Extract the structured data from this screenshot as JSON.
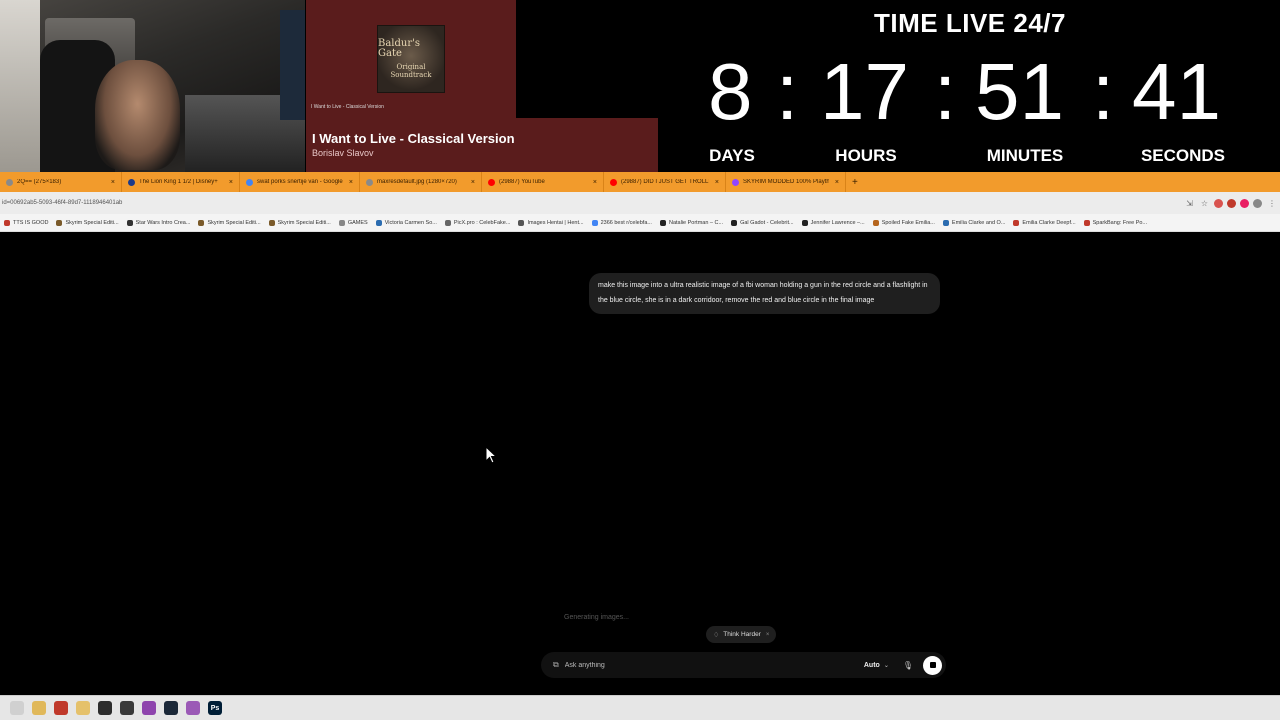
{
  "now_playing": {
    "album_title": "Baldur's Gate",
    "album_subtitle": "Original Soundtrack",
    "small_caption": "I Want to Live - Classical Version",
    "title": "I Want to Live - Classical Version",
    "artist": "Borislav Slavov",
    "color_bg": "#5a1c1c"
  },
  "countdown": {
    "title": "TIME LIVE 24/7",
    "days": "8",
    "hours": "17",
    "minutes": "51",
    "seconds": "41",
    "separator": ":",
    "days_label": "DAYS",
    "hours_label": "HOURS",
    "minutes_label": "MINUTES",
    "seconds_label": "SECONDS"
  },
  "browser": {
    "tab_color": "#f29b2c",
    "tabs": [
      {
        "label": "2Q== (275×183)",
        "icon": "image-icon",
        "color": "#8a8a8a"
      },
      {
        "label": "The Lion King 1 1/2 | Disney+",
        "icon": "disney-icon",
        "color": "#1b3a8a"
      },
      {
        "label": "swat porks snertije van - Google",
        "icon": "google-icon",
        "color": "#4285f4"
      },
      {
        "label": "maxresdefault.jpg (1280×720)",
        "icon": "image-icon",
        "color": "#8a8a8a"
      },
      {
        "label": "(29887) YouTube",
        "icon": "youtube-icon",
        "color": "#ff0000"
      },
      {
        "label": "(29887) DID I JUST GET TROLL!",
        "icon": "youtube-icon",
        "color": "#ff0000"
      },
      {
        "label": "SKYRIM MODDED 100% Playthr",
        "icon": "twitch-icon",
        "color": "#9146ff"
      }
    ],
    "new_tab": "+",
    "close_glyph": "×",
    "url": "id=00692ab5-5093-46f4-89d7-1118946401ab",
    "bookmarks": [
      "TTS IS GOOD",
      "Skyrim Special Editi...",
      "Star Wars Intro Crea...",
      "Skyrim Special Editi...",
      "Skyrim Special Editi...",
      "GAMES",
      "Victoria Carmen So...",
      "PicX.pro : CelebFake...",
      "Images Hentai | Hent...",
      "2366 best r/celebfa...",
      "Natalie Portman – C...",
      "Gal Gadot - Celebrit...",
      "Jennifer Lawrence –...",
      "Spoiled Fake Emilia...",
      "Emilia Clarke and O...",
      "Emilia Clarke Deepf...",
      "SparkBang: Free Po..."
    ]
  },
  "chat": {
    "user_message": "make this image into a ultra realistic image of a fbi woman holding a gun in the red circle and a flashlight in the blue circle, she is in a dark corridoor, remove the red and blue circle in the final image",
    "status": "Generating images...",
    "think_harder": "Think Harder",
    "input_placeholder": "Ask anything",
    "model": "Auto"
  },
  "taskbar": {
    "icons": [
      "windows-icon",
      "folder-icon",
      "chrome-icon",
      "notes-icon",
      "terminal-icon",
      "obs-icon",
      "app-icon",
      "steam-icon",
      "settings-icon",
      "photoshop-icon"
    ]
  }
}
